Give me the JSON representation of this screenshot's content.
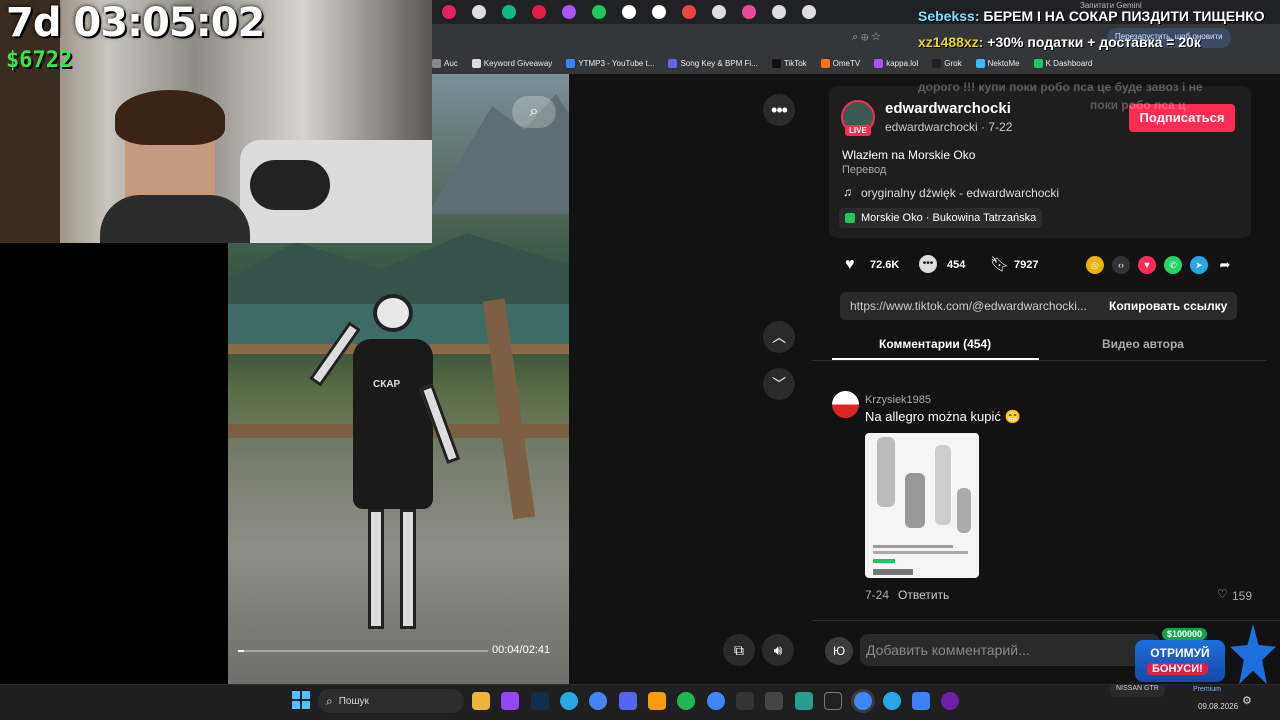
{
  "overlay": {
    "timer": "7d 03:05:02",
    "money": "$6722",
    "chat": [
      {
        "user": "Sebekss:",
        "text": "БЕРЕМ І НА СОКАР ПИЗДИТИ ТИЩЕНКО",
        "user_color": "#7fe0ff"
      },
      {
        "user": "xz1488xz:",
        "text": "+30% податки + доставка = 20к",
        "user_color": "#e6d22a"
      }
    ],
    "faded_chat": [
      "дорого !!! купи поки робо пса це буде завоз і не",
      "поки робо пса ц"
    ],
    "bonus": {
      "amount": "$100000",
      "line1": "ОТРИМУЙ",
      "line2": "БОНУСИ!"
    }
  },
  "browser": {
    "update_label": "Перезапустить, щоб оновити",
    "gemini_label": "Запитати Gemini",
    "bookmarks": [
      {
        "label": "Auc",
        "color": "#888"
      },
      {
        "label": "Keyword Giveaway",
        "color": "#ddd"
      },
      {
        "label": "YTMP3 - YouTube t...",
        "color": "#3b82f6"
      },
      {
        "label": "Song Key & BPM Fi...",
        "color": "#6366f1"
      },
      {
        "label": "TikTok",
        "color": "#111"
      },
      {
        "label": "OmeTV",
        "color": "#f97316"
      },
      {
        "label": "kappa.lol",
        "color": "#a855f7"
      },
      {
        "label": "Grok",
        "color": "#222"
      },
      {
        "label": "NektoMe",
        "color": "#38bdf8"
      },
      {
        "label": "K Dashboard",
        "color": "#22c55e"
      }
    ]
  },
  "video": {
    "time": "00:04/02:41",
    "backpack_text": "СКАР"
  },
  "post": {
    "username": "edwardwarchocki",
    "handle_date": "edwardwarchocki · 7-22",
    "live_badge": "LIVE",
    "subscribe_label": "Подписаться",
    "title": "Wlazłem na Morskie Oko",
    "translate": "Перевод",
    "sound": "oryginalny dźwięk - edwardwarchocki",
    "location": "Morskie Oko · Bukowina Tatrzańska",
    "likes": "72.6K",
    "comments": "454",
    "saves": "7927",
    "link": "https://www.tiktok.com/@edwardwarchocki...",
    "copy_label": "Копировать ссылку",
    "tab_comments": "Комментарии (454)",
    "tab_author": "Видео автора",
    "add_comment_placeholder": "Добавить комментарий...",
    "avatar_letter": "Ю"
  },
  "comment": {
    "user": "Krzysiek1985",
    "text": "Na allegro można kupić 😁",
    "date": "7-24",
    "reply_label": "Ответить",
    "likes": "159"
  },
  "taskbar": {
    "search_label": "Пошук",
    "date": "09.08.2026",
    "car_label": "NISSAN GTR",
    "premium_label": "Premium"
  }
}
